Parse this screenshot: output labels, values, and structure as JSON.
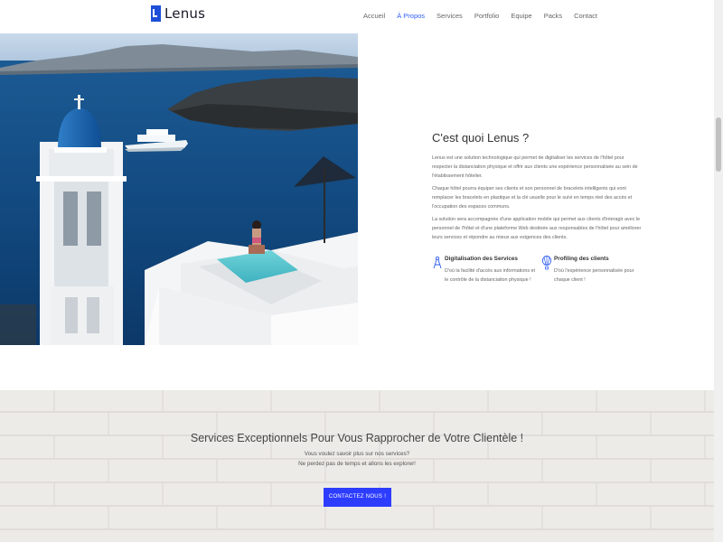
{
  "brand": {
    "name": "Lenus",
    "accent": "#2d5cf0",
    "cta_color": "#2d3dff"
  },
  "nav": {
    "items": [
      {
        "label": "Accueil"
      },
      {
        "label": "À Propos"
      },
      {
        "label": "Services"
      },
      {
        "label": "Portfolio"
      },
      {
        "label": "Equipe"
      },
      {
        "label": "Packs"
      },
      {
        "label": "Contact"
      }
    ],
    "active_index": 1
  },
  "about": {
    "title": "C'est quoi Lenus ?",
    "paragraphs": [
      "Lenus est une solution technologique qui permet de digitaliser les services de l'hôtel pour respecter la distanciation physique et offrir aux clients une expérience personnalisée au sein de l'établissement hôtelier.",
      "Chaque hôtel pourra équiper ses clients et son personnel de bracelets intelligents qui vont remplacer les bracelets en plastique et la clé usuelle pour le suivi en temps réel des accès et l'occupation des espaces communs.",
      "La solution sera accompagnée d'une application mobile qui permet aux clients d'interagir avec le personnel de l'hôtel et d'une plateforme Web destinée aux responsables de l'hôtel pour améliorer leurs services et répondre au mieux aux exigences des clients."
    ]
  },
  "features": [
    {
      "icon": "compass-icon",
      "title": "Digitalisation des Services",
      "text": "D'où la facilité d'accès aux informations et le contrôle de la distanciation physique !"
    },
    {
      "icon": "balloon-icon",
      "title": "Profiling des clients",
      "text": "D'où l'expérience personnalisée pour chaque client !"
    }
  ],
  "cta_section": {
    "title": "Services Exceptionnels Pour Vous Rapprocher de Votre Clientèle !",
    "line1": "Vous voulez savoir plus sur nos services?",
    "line2": "Ne perdez pas de temps et allons les explorer!",
    "button_label": "CONTACTEZ NOUS !"
  }
}
